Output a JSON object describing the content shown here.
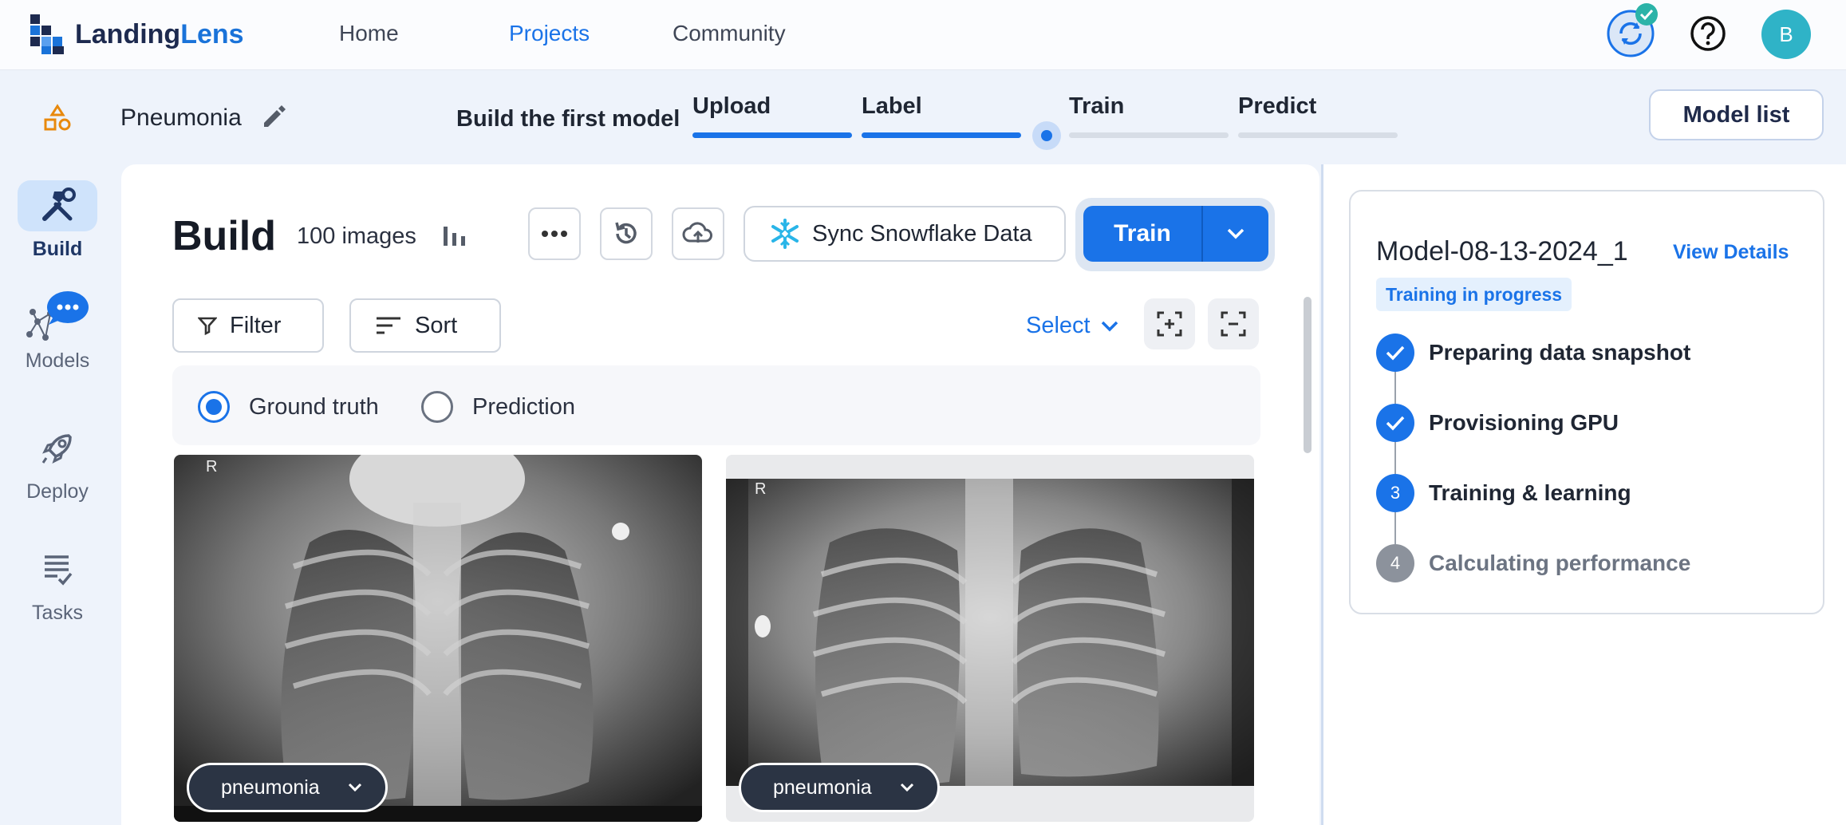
{
  "topnav": {
    "logo": {
      "part1": "Landing",
      "part2": "Lens"
    },
    "items": [
      {
        "label": "Home",
        "active": false
      },
      {
        "label": "Projects",
        "active": true
      },
      {
        "label": "Community",
        "active": false
      }
    ],
    "avatar_initial": "B"
  },
  "project": {
    "name": "Pneumonia",
    "build_first_model": "Build the first model",
    "steps": [
      {
        "label": "Upload",
        "status": "done"
      },
      {
        "label": "Label",
        "status": "done"
      },
      {
        "label": "Train",
        "status": "current"
      },
      {
        "label": "Predict",
        "status": "todo"
      }
    ],
    "model_list_label": "Model list"
  },
  "sidebar": {
    "items": [
      {
        "label": "Build",
        "icon": "hammer-wrench-icon",
        "active": true
      },
      {
        "label": "Models",
        "icon": "models-network-icon",
        "active": false
      },
      {
        "label": "Deploy",
        "icon": "rocket-icon",
        "active": false
      },
      {
        "label": "Tasks",
        "icon": "tasks-list-icon",
        "active": false
      }
    ]
  },
  "build": {
    "title": "Build",
    "image_count": "100 images",
    "snowflake_label": "Sync Snowflake Data",
    "train_label": "Train",
    "filter_label": "Filter",
    "sort_label": "Sort",
    "select_label": "Select",
    "view_mode": {
      "options": [
        {
          "label": "Ground truth",
          "selected": true
        },
        {
          "label": "Prediction",
          "selected": false
        }
      ]
    },
    "images": [
      {
        "marker": "R",
        "tag": "pneumonia"
      },
      {
        "marker": "R",
        "tag": "pneumonia"
      }
    ]
  },
  "training": {
    "model_name": "Model-08-13-2024_1",
    "view_details": "View Details",
    "status": "Training in progress",
    "steps": [
      {
        "label": "Preparing data snapshot",
        "state": "done",
        "badge": ""
      },
      {
        "label": "Provisioning GPU",
        "state": "done",
        "badge": ""
      },
      {
        "label": "Training & learning",
        "state": "active",
        "badge": "3"
      },
      {
        "label": "Calculating performance",
        "state": "pending",
        "badge": "4"
      }
    ]
  },
  "colors": {
    "accent": "#1a73e8",
    "brand_dark": "#1d2a4f",
    "page_bg": "#eef3fb"
  }
}
